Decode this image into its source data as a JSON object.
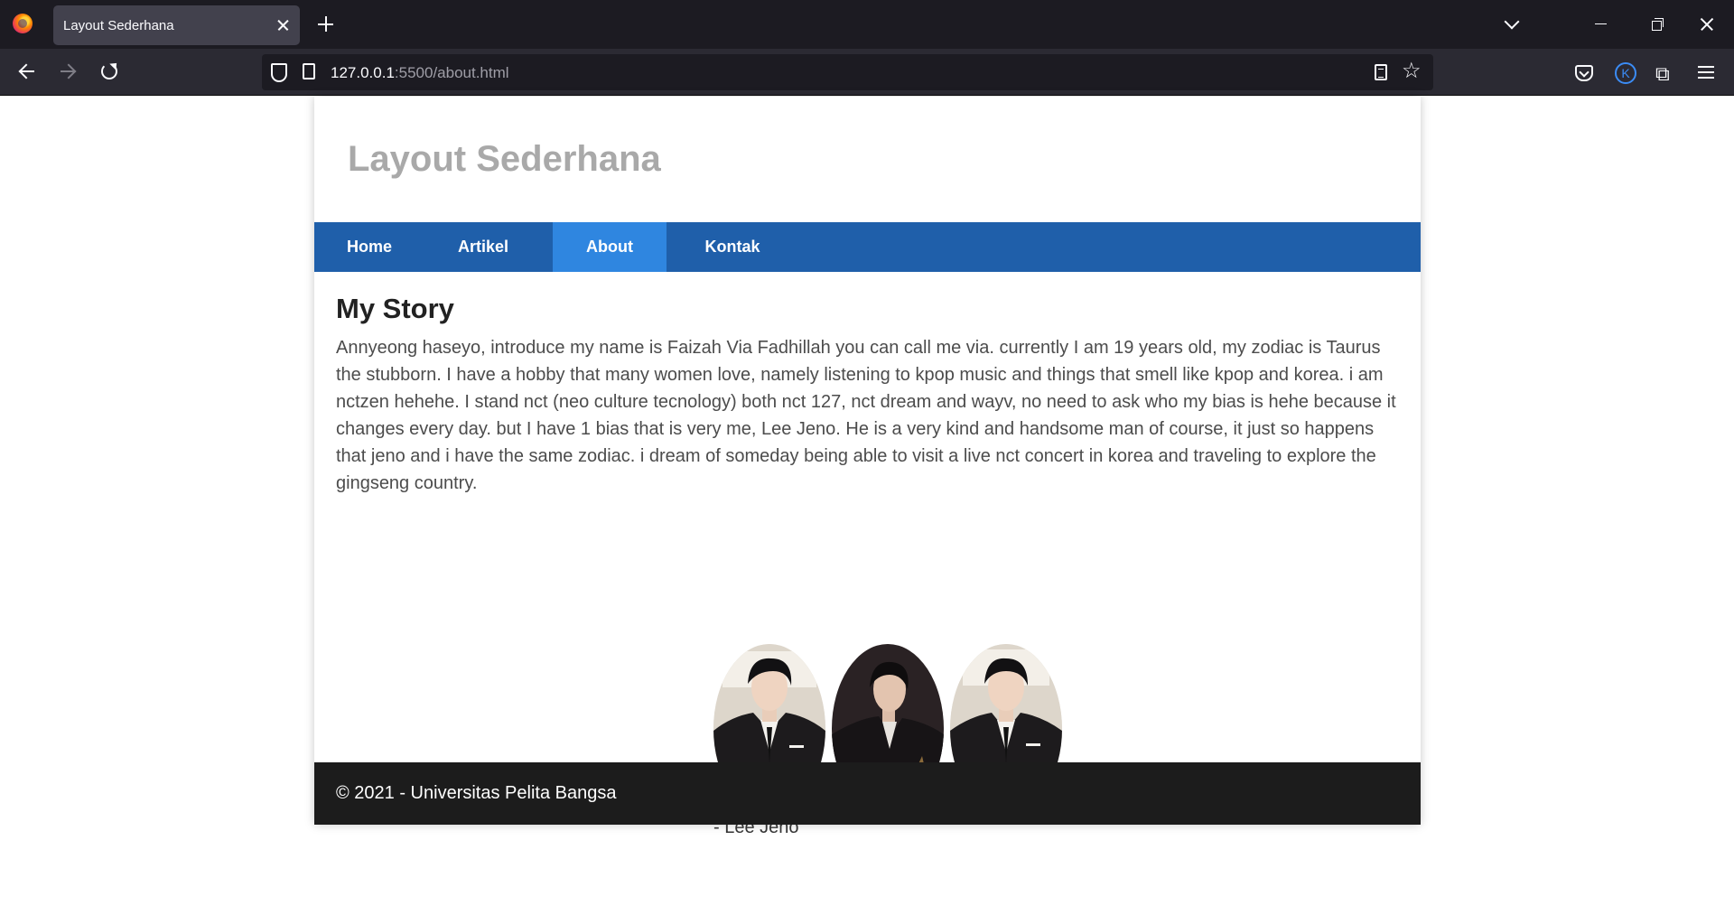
{
  "browser": {
    "tab_title": "Layout Sederhana",
    "url_host": "127.0.0.1",
    "url_rest": ":5500/about.html",
    "account_initial": "K"
  },
  "site": {
    "title": "Layout Sederhana",
    "nav": [
      {
        "label": "Home",
        "active": false
      },
      {
        "label": "Artikel",
        "active": false
      },
      {
        "label": "About",
        "active": true
      },
      {
        "label": "Kontak",
        "active": false
      }
    ],
    "accent_color": "#1f5faa",
    "active_color": "#2f86e0"
  },
  "main": {
    "heading": "My Story",
    "paragraph": "Annyeong haseyo, introduce my name is Faizah Via Fadhillah you can call me via. currently I am 19 years old, my zodiac is Taurus the stubborn. I have a hobby that many women love, namely listening to kpop music and things that smell like kpop and korea. i am nctzen hehehe. I stand nct (neo culture tecnology) both nct 127, nct dream and wayv, no need to ask who my bias is hehe because it changes every day. but I have 1 bias that is very me, Lee Jeno. He is a very kind and handsome man of course, it just so happens that jeno and i have the same zodiac. i dream of someday being able to visit a live nct concert in korea and traveling to explore the gingseng country.",
    "photo_caption": "- Lee Jeno"
  },
  "footer": {
    "text": "© 2021 - Universitas Pelita Bangsa"
  }
}
